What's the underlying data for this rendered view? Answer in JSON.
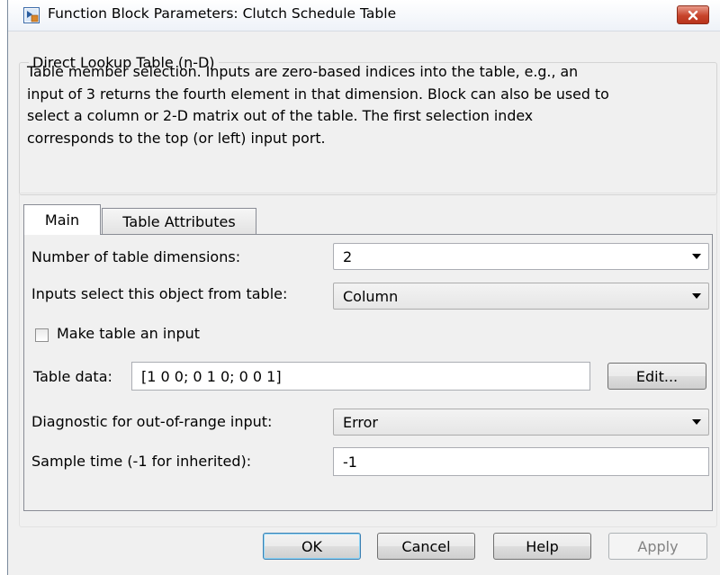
{
  "window": {
    "title": "Function Block Parameters: Clutch Schedule Table"
  },
  "block": {
    "group_label": "Direct Lookup Table (n-D)",
    "description_lines": [
      "Table member selection.  Inputs are zero-based indices into the table, e.g., an",
      "input of 3 returns the fourth element in that dimension. Block can also be used to",
      "select a column or 2-D matrix out of the table. The first selection index",
      "corresponds to the top (or left) input port."
    ]
  },
  "tabs": [
    {
      "label": "Main",
      "active": true
    },
    {
      "label": "Table Attributes",
      "active": false
    }
  ],
  "main": {
    "num_dims_label": "Number of table dimensions:",
    "num_dims_value": "2",
    "inputs_select_label": "Inputs select this object from table:",
    "inputs_select_value": "Column",
    "make_input_label": "Make table an input",
    "make_input_checked": false,
    "table_data_label": "Table data:",
    "table_data_value": "[1 0 0; 0 1 0; 0 0 1]",
    "edit_label": "Edit...",
    "diagnostic_label": "Diagnostic for out-of-range input:",
    "diagnostic_value": "Error",
    "sample_time_label": "Sample time (-1 for inherited):",
    "sample_time_value": "-1"
  },
  "buttons": {
    "ok": "OK",
    "cancel": "Cancel",
    "help": "Help",
    "apply": "Apply"
  },
  "icons": {
    "app": "simulink-block-icon",
    "close": "close-icon"
  },
  "colors": {
    "close_button": "#c7442b",
    "default_button_border": "#3c7fb1"
  }
}
